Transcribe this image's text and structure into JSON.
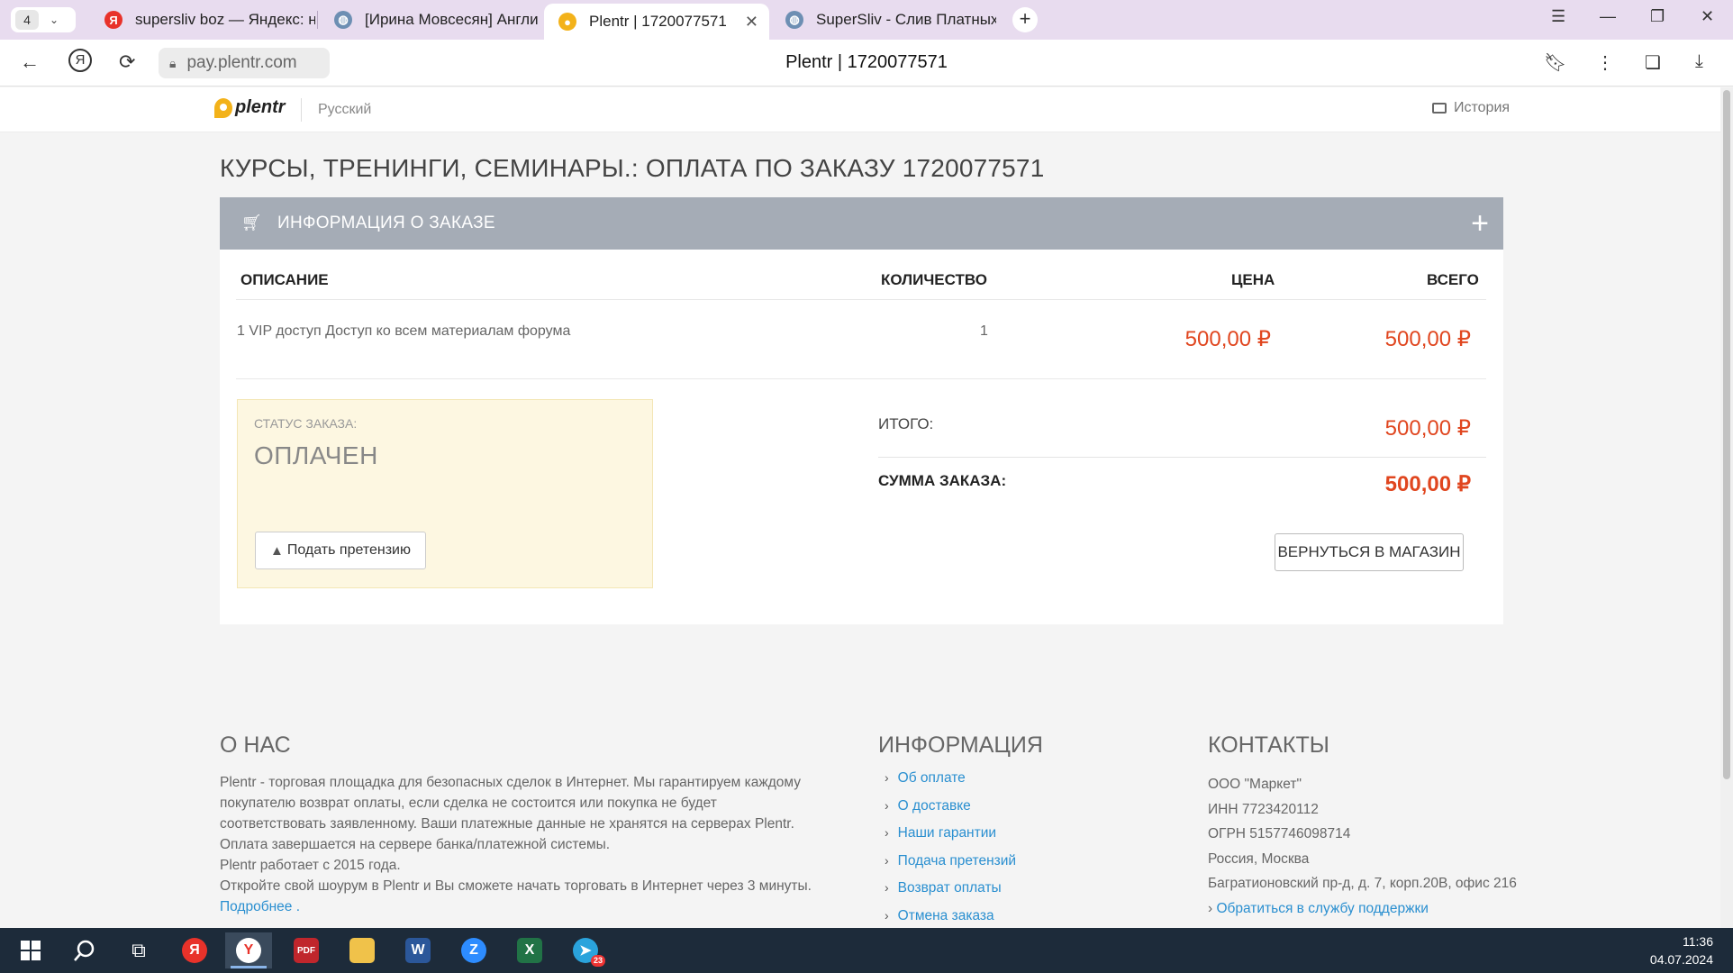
{
  "browser": {
    "tab_count": "4",
    "tabs": [
      {
        "title": "supersliv boz — Яндекс: на",
        "favicon": "yandex-icon",
        "color": "#e8322a"
      },
      {
        "title": "[Ирина Мовсесян] Англи",
        "favicon": "globe-icon",
        "color": "#6d8fb3"
      },
      {
        "title": "Plentr | 1720077571",
        "favicon": "plentr-icon",
        "color": "#f3b21a",
        "active": true
      },
      {
        "title": "SuperSliv - Слив Платных",
        "favicon": "globe-icon",
        "color": "#6d8fb3"
      }
    ],
    "url": "pay.plentr.com",
    "page_title": "Plentr | 1720077571"
  },
  "site": {
    "logo": "plentr",
    "language": "Русский",
    "history": "История"
  },
  "order": {
    "title": "КУРСЫ, ТРЕНИНГИ, СЕМИНАРЫ.: ОПЛАТА ПО ЗАКАЗУ 1720077571",
    "panel_title": "ИНФОРМАЦИЯ О ЗАКАЗЕ",
    "columns": {
      "description": "ОПИСАНИЕ",
      "quantity": "КОЛИЧЕСТВО",
      "price": "ЦЕНА",
      "total": "ВСЕГО"
    },
    "items": [
      {
        "description": "1 VIP доступ Доступ ко всем материалам форума",
        "quantity": "1",
        "price": "500,00 ₽",
        "total": "500,00 ₽"
      }
    ],
    "status_label": "СТАТУС ЗАКАЗА:",
    "status_value": "ОПЛАЧЕН",
    "claim_button": "Подать претензию",
    "subtotal_label": "ИТОГО:",
    "subtotal_value": "500,00 ₽",
    "sum_label": "СУММА ЗАКАЗА:",
    "sum_value": "500,00 ₽",
    "back_button": "ВЕРНУТЬСЯ В МАГАЗИН"
  },
  "footer": {
    "about_title": "О НАС",
    "about_lines": [
      "Plentr - торговая площадка для безопасных сделок в Интернет. Мы гарантируем каждому покупателю возврат оплаты, если сделка не состоится или покупка не будет соответствовать заявленному. Ваши платежные данные не хранятся на серверах Plentr. Оплата завершается на сервере банка/платежной системы.",
      "Plentr работает с 2015 года.",
      "Откройте свой шоурум в Plentr и Вы сможете начать торговать в Интернет через 3 минуты."
    ],
    "more_link": "Подробнее .",
    "info_title": "ИНФОРМАЦИЯ",
    "info_links": [
      "Об оплате",
      "О доставке",
      "Наши гарантии",
      "Подача претензий",
      "Возврат оплаты",
      "Отмена заказа"
    ],
    "contacts_title": "КОНТАКТЫ",
    "contacts": [
      "ООО \"Маркет\"",
      "ИНН 7723420112",
      "ОГРН 5157746098714",
      "Россия, Москва",
      "Багратионовский пр-д, д. 7, корп.20В, офис 216"
    ],
    "support_link": "Обратиться в службу поддержки"
  },
  "taskbar": {
    "time": "11:36",
    "date": "04.07.2024",
    "telegram_badge": "23",
    "apps": [
      {
        "name": "yandex-app-icon",
        "glyph": "Я",
        "color": "#e8322a"
      },
      {
        "name": "yandex-browser-icon",
        "glyph": "Y",
        "color": "#e8322a"
      },
      {
        "name": "pdf-app-icon",
        "glyph": "PDF",
        "color": "#c0262c"
      },
      {
        "name": "file-explorer-icon",
        "glyph": "▬",
        "color": "#f0c24a"
      },
      {
        "name": "word-icon",
        "glyph": "W",
        "color": "#2b579a"
      },
      {
        "name": "zoom-icon",
        "glyph": "Z",
        "color": "#2d8cff"
      },
      {
        "name": "excel-icon",
        "glyph": "X",
        "color": "#217346"
      },
      {
        "name": "telegram-icon",
        "glyph": "➤",
        "color": "#2aa3dc"
      }
    ]
  }
}
